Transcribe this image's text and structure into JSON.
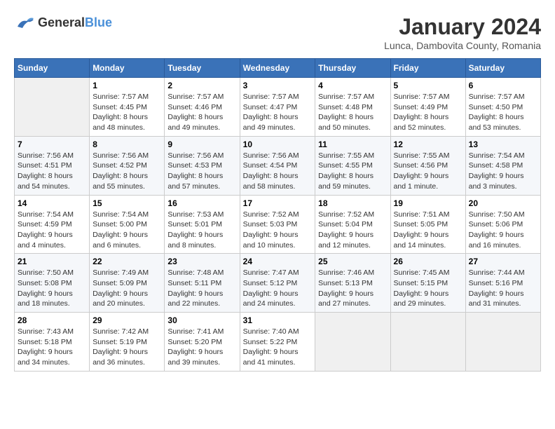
{
  "header": {
    "logo": {
      "line1": "General",
      "line2": "Blue"
    },
    "title": "January 2024",
    "location": "Lunca, Dambovita County, Romania"
  },
  "weekdays": [
    "Sunday",
    "Monday",
    "Tuesday",
    "Wednesday",
    "Thursday",
    "Friday",
    "Saturday"
  ],
  "weeks": [
    [
      {
        "day": "",
        "info": ""
      },
      {
        "day": "1",
        "info": "Sunrise: 7:57 AM\nSunset: 4:45 PM\nDaylight: 8 hours\nand 48 minutes."
      },
      {
        "day": "2",
        "info": "Sunrise: 7:57 AM\nSunset: 4:46 PM\nDaylight: 8 hours\nand 49 minutes."
      },
      {
        "day": "3",
        "info": "Sunrise: 7:57 AM\nSunset: 4:47 PM\nDaylight: 8 hours\nand 49 minutes."
      },
      {
        "day": "4",
        "info": "Sunrise: 7:57 AM\nSunset: 4:48 PM\nDaylight: 8 hours\nand 50 minutes."
      },
      {
        "day": "5",
        "info": "Sunrise: 7:57 AM\nSunset: 4:49 PM\nDaylight: 8 hours\nand 52 minutes."
      },
      {
        "day": "6",
        "info": "Sunrise: 7:57 AM\nSunset: 4:50 PM\nDaylight: 8 hours\nand 53 minutes."
      }
    ],
    [
      {
        "day": "7",
        "info": "Sunrise: 7:56 AM\nSunset: 4:51 PM\nDaylight: 8 hours\nand 54 minutes."
      },
      {
        "day": "8",
        "info": "Sunrise: 7:56 AM\nSunset: 4:52 PM\nDaylight: 8 hours\nand 55 minutes."
      },
      {
        "day": "9",
        "info": "Sunrise: 7:56 AM\nSunset: 4:53 PM\nDaylight: 8 hours\nand 57 minutes."
      },
      {
        "day": "10",
        "info": "Sunrise: 7:56 AM\nSunset: 4:54 PM\nDaylight: 8 hours\nand 58 minutes."
      },
      {
        "day": "11",
        "info": "Sunrise: 7:55 AM\nSunset: 4:55 PM\nDaylight: 8 hours\nand 59 minutes."
      },
      {
        "day": "12",
        "info": "Sunrise: 7:55 AM\nSunset: 4:56 PM\nDaylight: 9 hours\nand 1 minute."
      },
      {
        "day": "13",
        "info": "Sunrise: 7:54 AM\nSunset: 4:58 PM\nDaylight: 9 hours\nand 3 minutes."
      }
    ],
    [
      {
        "day": "14",
        "info": "Sunrise: 7:54 AM\nSunset: 4:59 PM\nDaylight: 9 hours\nand 4 minutes."
      },
      {
        "day": "15",
        "info": "Sunrise: 7:54 AM\nSunset: 5:00 PM\nDaylight: 9 hours\nand 6 minutes."
      },
      {
        "day": "16",
        "info": "Sunrise: 7:53 AM\nSunset: 5:01 PM\nDaylight: 9 hours\nand 8 minutes."
      },
      {
        "day": "17",
        "info": "Sunrise: 7:52 AM\nSunset: 5:03 PM\nDaylight: 9 hours\nand 10 minutes."
      },
      {
        "day": "18",
        "info": "Sunrise: 7:52 AM\nSunset: 5:04 PM\nDaylight: 9 hours\nand 12 minutes."
      },
      {
        "day": "19",
        "info": "Sunrise: 7:51 AM\nSunset: 5:05 PM\nDaylight: 9 hours\nand 14 minutes."
      },
      {
        "day": "20",
        "info": "Sunrise: 7:50 AM\nSunset: 5:06 PM\nDaylight: 9 hours\nand 16 minutes."
      }
    ],
    [
      {
        "day": "21",
        "info": "Sunrise: 7:50 AM\nSunset: 5:08 PM\nDaylight: 9 hours\nand 18 minutes."
      },
      {
        "day": "22",
        "info": "Sunrise: 7:49 AM\nSunset: 5:09 PM\nDaylight: 9 hours\nand 20 minutes."
      },
      {
        "day": "23",
        "info": "Sunrise: 7:48 AM\nSunset: 5:11 PM\nDaylight: 9 hours\nand 22 minutes."
      },
      {
        "day": "24",
        "info": "Sunrise: 7:47 AM\nSunset: 5:12 PM\nDaylight: 9 hours\nand 24 minutes."
      },
      {
        "day": "25",
        "info": "Sunrise: 7:46 AM\nSunset: 5:13 PM\nDaylight: 9 hours\nand 27 minutes."
      },
      {
        "day": "26",
        "info": "Sunrise: 7:45 AM\nSunset: 5:15 PM\nDaylight: 9 hours\nand 29 minutes."
      },
      {
        "day": "27",
        "info": "Sunrise: 7:44 AM\nSunset: 5:16 PM\nDaylight: 9 hours\nand 31 minutes."
      }
    ],
    [
      {
        "day": "28",
        "info": "Sunrise: 7:43 AM\nSunset: 5:18 PM\nDaylight: 9 hours\nand 34 minutes."
      },
      {
        "day": "29",
        "info": "Sunrise: 7:42 AM\nSunset: 5:19 PM\nDaylight: 9 hours\nand 36 minutes."
      },
      {
        "day": "30",
        "info": "Sunrise: 7:41 AM\nSunset: 5:20 PM\nDaylight: 9 hours\nand 39 minutes."
      },
      {
        "day": "31",
        "info": "Sunrise: 7:40 AM\nSunset: 5:22 PM\nDaylight: 9 hours\nand 41 minutes."
      },
      {
        "day": "",
        "info": ""
      },
      {
        "day": "",
        "info": ""
      },
      {
        "day": "",
        "info": ""
      }
    ]
  ]
}
